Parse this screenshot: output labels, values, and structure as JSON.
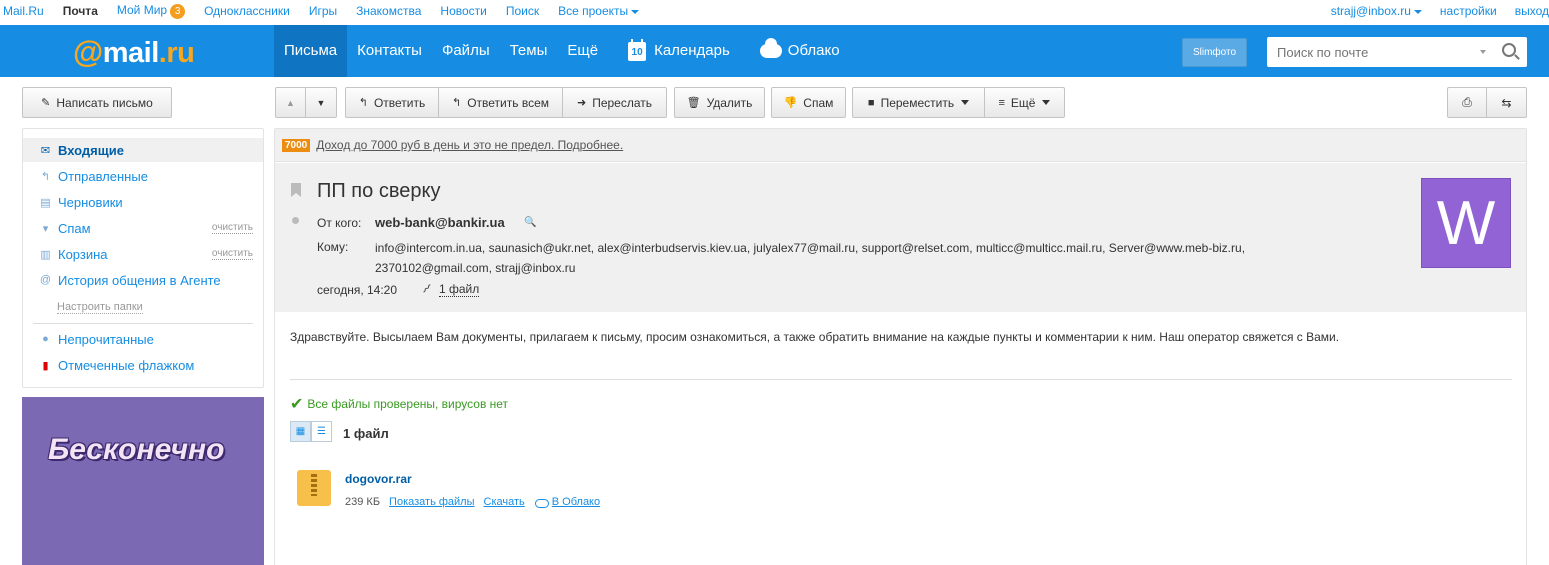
{
  "portal": {
    "links": [
      "Mail.Ru",
      "Почта",
      "Мой Мир",
      "Одноклассники",
      "Игры",
      "Знакомства",
      "Новости",
      "Поиск",
      "Все проекты"
    ],
    "moimir_badge": "3",
    "user_email": "strajj@inbox.ru",
    "settings": "настройки",
    "logout": "выход"
  },
  "header": {
    "logo_at": "@",
    "logo_mail": "mail",
    "logo_ru": ".ru",
    "tabs": [
      "Письма",
      "Контакты",
      "Файлы",
      "Темы",
      "Ещё"
    ],
    "calendar_day": "10",
    "calendar_label": "Календарь",
    "cloud_label": "Облако",
    "slimfoto": "Slimфото",
    "search_placeholder": "Поиск по почте"
  },
  "toolbar": {
    "compose": "Написать письмо",
    "reply": "Ответить",
    "reply_all": "Ответить всем",
    "forward": "Переслать",
    "delete": "Удалить",
    "spam": "Спам",
    "move": "Переместить",
    "more": "Ещё"
  },
  "sidebar": {
    "folders": [
      {
        "label": "Входящие"
      },
      {
        "label": "Отправленные"
      },
      {
        "label": "Черновики"
      },
      {
        "label": "Спам",
        "action": "очистить"
      },
      {
        "label": "Корзина",
        "action": "очистить"
      },
      {
        "label": "История общения в Агенте"
      }
    ],
    "setup_folders": "Настроить папки",
    "unread": "Непрочитанные",
    "flagged": "Отмеченные флажком",
    "promo": "Бесконечно"
  },
  "letter": {
    "ad_badge": "7000",
    "ad_text": "Доход до 7000 руб в день и это не предел. Подробнее.",
    "subject": "ПП по сверку",
    "from_label": "От кого:",
    "from": "web-bank@bankir.ua",
    "to_label": "Кому:",
    "to": "info@intercom.in.ua, saunasich@ukr.net, alex@interbudservis.kiev.ua, julyalex77@mail.ru, support@relset.com, multicc@multicc.mail.ru, Server@www.meb-biz.ru, 2370102@gmail.com, strajj@inbox.ru",
    "date": "сегодня, 14:20",
    "attachments_link": "1 файл",
    "avatar_letter": "W",
    "body": "Здравствуйте. Высылаем Вам документы, прилагаем к письму, просим ознакомиться, а также обратить внимание на каждые пункты и комментарии к ним. Наш оператор свяжется с Вами.",
    "virus_check": "Все файлы проверены, вирусов нет",
    "files_count": "1 файл",
    "file": {
      "name": "dogovor.rar",
      "size": "239 КБ",
      "show_files": "Показать файлы",
      "download": "Скачать",
      "to_cloud": "В Облако"
    }
  }
}
